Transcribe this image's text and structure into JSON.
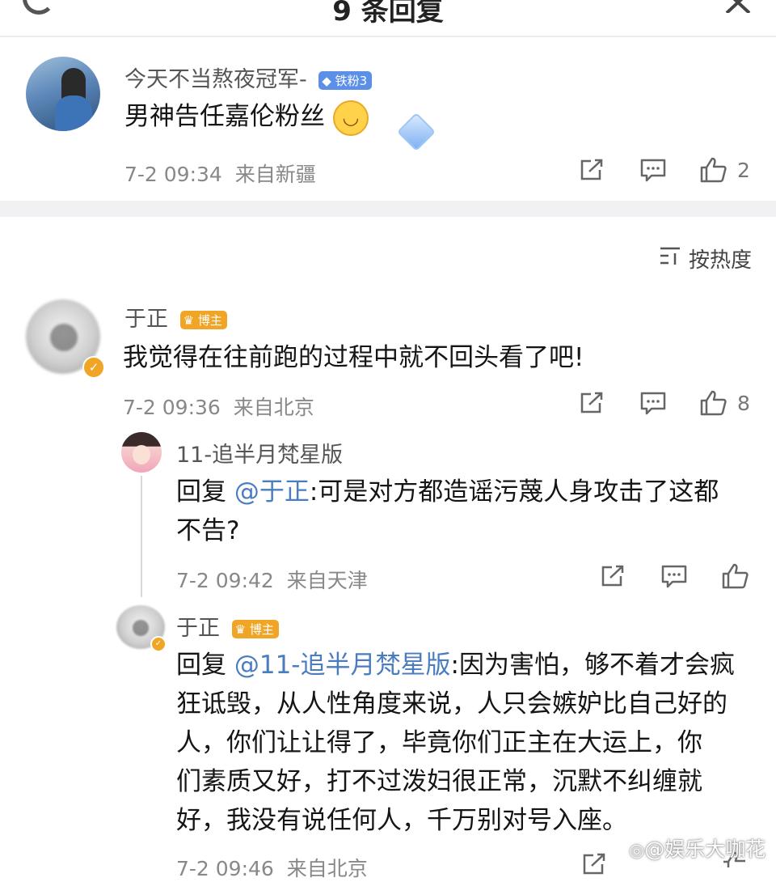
{
  "header": {
    "title": "9 条回复"
  },
  "root": {
    "username": "今天不当熬夜冠军-",
    "badge": "铁粉3",
    "text": "男神告任嘉伦粉丝",
    "time": "7-2 09:34",
    "location": "来自新疆",
    "likes": "2"
  },
  "sort": {
    "label": "按热度"
  },
  "comments": [
    {
      "username": "于正",
      "badge": "博主",
      "text": "我觉得在往前跑的过程中就不回头看了吧!",
      "time": "7-2 09:36",
      "location": "来自北京",
      "likes": "8"
    },
    {
      "username": "11-追半月梵星版",
      "reply_prefix": "回复",
      "mention": "@于正",
      "text_line1": ":可是对方都造谣污蔑人身攻击了这都",
      "text_line2": "不告?",
      "time": "7-2 09:42",
      "location": "来自天津"
    },
    {
      "username": "于正",
      "badge": "博主",
      "reply_prefix": "回复",
      "mention": "@11-追半月梵星版",
      "text_line1": ":因为害怕，够不着才会疯",
      "text_line2": "狂诋毁，从人性角度来说，人只会嫉妒比自己好的",
      "text_line3": "人，你们让让得了，毕竟你们正主在大运上，你",
      "text_line4": "们素质又好，打不过泼妇很正常，沉默不纠缠就",
      "text_line5": "好，我没有说任何人，千万别对号入座。",
      "time": "7-2 09:46",
      "location": "来自北京"
    }
  ],
  "watermark": "@娱乐大咖花",
  "colors": {
    "mention": "#4a7dbf",
    "badge_blue": "#5b8fe8",
    "badge_gold": "#f0a526",
    "band": "#f1f1f3"
  }
}
